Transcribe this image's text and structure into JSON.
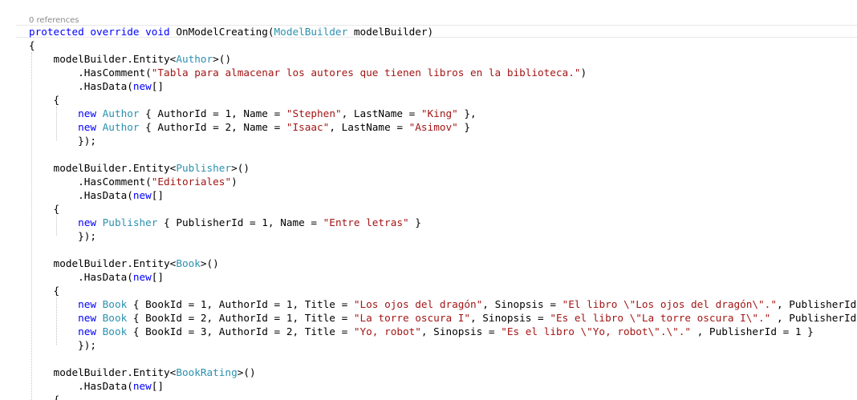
{
  "editor": {
    "codelens": "0 references",
    "colors": {
      "keyword": "#0000ff",
      "type": "#2b91af",
      "string": "#a31515",
      "plain": "#000000",
      "codelens": "#8a8a8a"
    },
    "lines": [
      [
        {
          "k": "kw",
          "t": "protected override void "
        },
        {
          "k": "pl",
          "t": "OnModelCreating("
        },
        {
          "k": "ty",
          "t": "ModelBuilder"
        },
        {
          "k": "pl",
          "t": " modelBuilder)"
        }
      ],
      [
        {
          "k": "pl",
          "t": "{"
        }
      ],
      [
        {
          "k": "pl",
          "t": "    modelBuilder.Entity<"
        },
        {
          "k": "ty",
          "t": "Author"
        },
        {
          "k": "pl",
          "t": ">()"
        }
      ],
      [
        {
          "k": "pl",
          "t": "        .HasComment("
        },
        {
          "k": "st",
          "t": "\"Tabla para almacenar los autores que tienen libros en la biblioteca.\""
        },
        {
          "k": "pl",
          "t": ")"
        }
      ],
      [
        {
          "k": "pl",
          "t": "        .HasData("
        },
        {
          "k": "kw",
          "t": "new"
        },
        {
          "k": "pl",
          "t": "[]"
        }
      ],
      [
        {
          "k": "pl",
          "t": "    {"
        }
      ],
      [
        {
          "k": "pl",
          "t": "        "
        },
        {
          "k": "kw",
          "t": "new "
        },
        {
          "k": "ty",
          "t": "Author"
        },
        {
          "k": "pl",
          "t": " { AuthorId = 1, Name = "
        },
        {
          "k": "st",
          "t": "\"Stephen\""
        },
        {
          "k": "pl",
          "t": ", LastName = "
        },
        {
          "k": "st",
          "t": "\"King\""
        },
        {
          "k": "pl",
          "t": " },"
        }
      ],
      [
        {
          "k": "pl",
          "t": "        "
        },
        {
          "k": "kw",
          "t": "new "
        },
        {
          "k": "ty",
          "t": "Author"
        },
        {
          "k": "pl",
          "t": " { AuthorId = 2, Name = "
        },
        {
          "k": "st",
          "t": "\"Isaac\""
        },
        {
          "k": "pl",
          "t": ", LastName = "
        },
        {
          "k": "st",
          "t": "\"Asimov\""
        },
        {
          "k": "pl",
          "t": " }"
        }
      ],
      [
        {
          "k": "pl",
          "t": "        });"
        }
      ],
      [],
      [
        {
          "k": "pl",
          "t": "    modelBuilder.Entity<"
        },
        {
          "k": "ty",
          "t": "Publisher"
        },
        {
          "k": "pl",
          "t": ">()"
        }
      ],
      [
        {
          "k": "pl",
          "t": "        .HasComment("
        },
        {
          "k": "st",
          "t": "\"Editoriales\""
        },
        {
          "k": "pl",
          "t": ")"
        }
      ],
      [
        {
          "k": "pl",
          "t": "        .HasData("
        },
        {
          "k": "kw",
          "t": "new"
        },
        {
          "k": "pl",
          "t": "[]"
        }
      ],
      [
        {
          "k": "pl",
          "t": "    {"
        }
      ],
      [
        {
          "k": "pl",
          "t": "        "
        },
        {
          "k": "kw",
          "t": "new "
        },
        {
          "k": "ty",
          "t": "Publisher"
        },
        {
          "k": "pl",
          "t": " { PublisherId = 1, Name = "
        },
        {
          "k": "st",
          "t": "\"Entre letras\""
        },
        {
          "k": "pl",
          "t": " }"
        }
      ],
      [
        {
          "k": "pl",
          "t": "        });"
        }
      ],
      [],
      [
        {
          "k": "pl",
          "t": "    modelBuilder.Entity<"
        },
        {
          "k": "ty",
          "t": "Book"
        },
        {
          "k": "pl",
          "t": ">()"
        }
      ],
      [
        {
          "k": "pl",
          "t": "        .HasData("
        },
        {
          "k": "kw",
          "t": "new"
        },
        {
          "k": "pl",
          "t": "[]"
        }
      ],
      [
        {
          "k": "pl",
          "t": "    {"
        }
      ],
      [
        {
          "k": "pl",
          "t": "        "
        },
        {
          "k": "kw",
          "t": "new "
        },
        {
          "k": "ty",
          "t": "Book"
        },
        {
          "k": "pl",
          "t": " { BookId = 1, AuthorId = 1, Title = "
        },
        {
          "k": "st",
          "t": "\"Los ojos del dragón\""
        },
        {
          "k": "pl",
          "t": ", Sinopsis = "
        },
        {
          "k": "st",
          "t": "\"El libro \\\"Los ojos del dragón\\\".\""
        },
        {
          "k": "pl",
          "t": ", PublisherId"
        }
      ],
      [
        {
          "k": "pl",
          "t": "        "
        },
        {
          "k": "kw",
          "t": "new "
        },
        {
          "k": "ty",
          "t": "Book"
        },
        {
          "k": "pl",
          "t": " { BookId = 2, AuthorId = 1, Title = "
        },
        {
          "k": "st",
          "t": "\"La torre oscura I\""
        },
        {
          "k": "pl",
          "t": ", Sinopsis = "
        },
        {
          "k": "st",
          "t": "\"Es el libro \\\"La torre oscura I\\\".\""
        },
        {
          "k": "pl",
          "t": " , PublisherId"
        }
      ],
      [
        {
          "k": "pl",
          "t": "        "
        },
        {
          "k": "kw",
          "t": "new "
        },
        {
          "k": "ty",
          "t": "Book"
        },
        {
          "k": "pl",
          "t": " { BookId = 3, AuthorId = 2, Title = "
        },
        {
          "k": "st",
          "t": "\"Yo, robot\""
        },
        {
          "k": "pl",
          "t": ", Sinopsis = "
        },
        {
          "k": "st",
          "t": "\"Es el libro \\\"Yo, robot\\\".\\\".\""
        },
        {
          "k": "pl",
          "t": " , PublisherId = 1 }"
        }
      ],
      [
        {
          "k": "pl",
          "t": "        });"
        }
      ],
      [],
      [
        {
          "k": "pl",
          "t": "    modelBuilder.Entity<"
        },
        {
          "k": "ty",
          "t": "BookRating"
        },
        {
          "k": "pl",
          "t": ">()"
        }
      ],
      [
        {
          "k": "pl",
          "t": "        .HasData("
        },
        {
          "k": "kw",
          "t": "new"
        },
        {
          "k": "pl",
          "t": "[]"
        }
      ],
      [
        {
          "k": "pl",
          "t": "    {"
        }
      ]
    ]
  }
}
